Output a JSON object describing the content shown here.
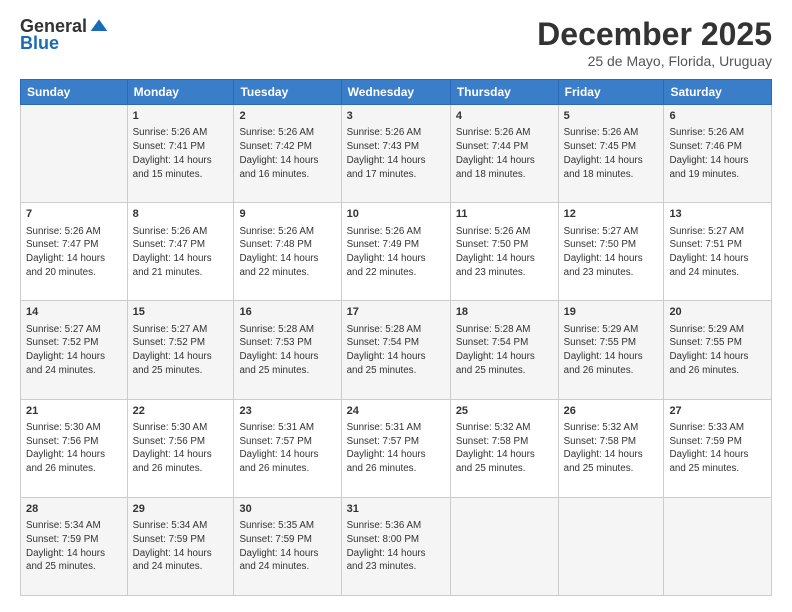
{
  "header": {
    "logo_line1": "General",
    "logo_line2": "Blue",
    "month_title": "December 2025",
    "subtitle": "25 de Mayo, Florida, Uruguay"
  },
  "calendar": {
    "days_of_week": [
      "Sunday",
      "Monday",
      "Tuesday",
      "Wednesday",
      "Thursday",
      "Friday",
      "Saturday"
    ],
    "weeks": [
      [
        {
          "day": "",
          "info": ""
        },
        {
          "day": "1",
          "info": "Sunrise: 5:26 AM\nSunset: 7:41 PM\nDaylight: 14 hours\nand 15 minutes."
        },
        {
          "day": "2",
          "info": "Sunrise: 5:26 AM\nSunset: 7:42 PM\nDaylight: 14 hours\nand 16 minutes."
        },
        {
          "day": "3",
          "info": "Sunrise: 5:26 AM\nSunset: 7:43 PM\nDaylight: 14 hours\nand 17 minutes."
        },
        {
          "day": "4",
          "info": "Sunrise: 5:26 AM\nSunset: 7:44 PM\nDaylight: 14 hours\nand 18 minutes."
        },
        {
          "day": "5",
          "info": "Sunrise: 5:26 AM\nSunset: 7:45 PM\nDaylight: 14 hours\nand 18 minutes."
        },
        {
          "day": "6",
          "info": "Sunrise: 5:26 AM\nSunset: 7:46 PM\nDaylight: 14 hours\nand 19 minutes."
        }
      ],
      [
        {
          "day": "7",
          "info": "Sunrise: 5:26 AM\nSunset: 7:47 PM\nDaylight: 14 hours\nand 20 minutes."
        },
        {
          "day": "8",
          "info": "Sunrise: 5:26 AM\nSunset: 7:47 PM\nDaylight: 14 hours\nand 21 minutes."
        },
        {
          "day": "9",
          "info": "Sunrise: 5:26 AM\nSunset: 7:48 PM\nDaylight: 14 hours\nand 22 minutes."
        },
        {
          "day": "10",
          "info": "Sunrise: 5:26 AM\nSunset: 7:49 PM\nDaylight: 14 hours\nand 22 minutes."
        },
        {
          "day": "11",
          "info": "Sunrise: 5:26 AM\nSunset: 7:50 PM\nDaylight: 14 hours\nand 23 minutes."
        },
        {
          "day": "12",
          "info": "Sunrise: 5:27 AM\nSunset: 7:50 PM\nDaylight: 14 hours\nand 23 minutes."
        },
        {
          "day": "13",
          "info": "Sunrise: 5:27 AM\nSunset: 7:51 PM\nDaylight: 14 hours\nand 24 minutes."
        }
      ],
      [
        {
          "day": "14",
          "info": "Sunrise: 5:27 AM\nSunset: 7:52 PM\nDaylight: 14 hours\nand 24 minutes."
        },
        {
          "day": "15",
          "info": "Sunrise: 5:27 AM\nSunset: 7:52 PM\nDaylight: 14 hours\nand 25 minutes."
        },
        {
          "day": "16",
          "info": "Sunrise: 5:28 AM\nSunset: 7:53 PM\nDaylight: 14 hours\nand 25 minutes."
        },
        {
          "day": "17",
          "info": "Sunrise: 5:28 AM\nSunset: 7:54 PM\nDaylight: 14 hours\nand 25 minutes."
        },
        {
          "day": "18",
          "info": "Sunrise: 5:28 AM\nSunset: 7:54 PM\nDaylight: 14 hours\nand 25 minutes."
        },
        {
          "day": "19",
          "info": "Sunrise: 5:29 AM\nSunset: 7:55 PM\nDaylight: 14 hours\nand 26 minutes."
        },
        {
          "day": "20",
          "info": "Sunrise: 5:29 AM\nSunset: 7:55 PM\nDaylight: 14 hours\nand 26 minutes."
        }
      ],
      [
        {
          "day": "21",
          "info": "Sunrise: 5:30 AM\nSunset: 7:56 PM\nDaylight: 14 hours\nand 26 minutes."
        },
        {
          "day": "22",
          "info": "Sunrise: 5:30 AM\nSunset: 7:56 PM\nDaylight: 14 hours\nand 26 minutes."
        },
        {
          "day": "23",
          "info": "Sunrise: 5:31 AM\nSunset: 7:57 PM\nDaylight: 14 hours\nand 26 minutes."
        },
        {
          "day": "24",
          "info": "Sunrise: 5:31 AM\nSunset: 7:57 PM\nDaylight: 14 hours\nand 26 minutes."
        },
        {
          "day": "25",
          "info": "Sunrise: 5:32 AM\nSunset: 7:58 PM\nDaylight: 14 hours\nand 25 minutes."
        },
        {
          "day": "26",
          "info": "Sunrise: 5:32 AM\nSunset: 7:58 PM\nDaylight: 14 hours\nand 25 minutes."
        },
        {
          "day": "27",
          "info": "Sunrise: 5:33 AM\nSunset: 7:59 PM\nDaylight: 14 hours\nand 25 minutes."
        }
      ],
      [
        {
          "day": "28",
          "info": "Sunrise: 5:34 AM\nSunset: 7:59 PM\nDaylight: 14 hours\nand 25 minutes."
        },
        {
          "day": "29",
          "info": "Sunrise: 5:34 AM\nSunset: 7:59 PM\nDaylight: 14 hours\nand 24 minutes."
        },
        {
          "day": "30",
          "info": "Sunrise: 5:35 AM\nSunset: 7:59 PM\nDaylight: 14 hours\nand 24 minutes."
        },
        {
          "day": "31",
          "info": "Sunrise: 5:36 AM\nSunset: 8:00 PM\nDaylight: 14 hours\nand 23 minutes."
        },
        {
          "day": "",
          "info": ""
        },
        {
          "day": "",
          "info": ""
        },
        {
          "day": "",
          "info": ""
        }
      ]
    ]
  }
}
